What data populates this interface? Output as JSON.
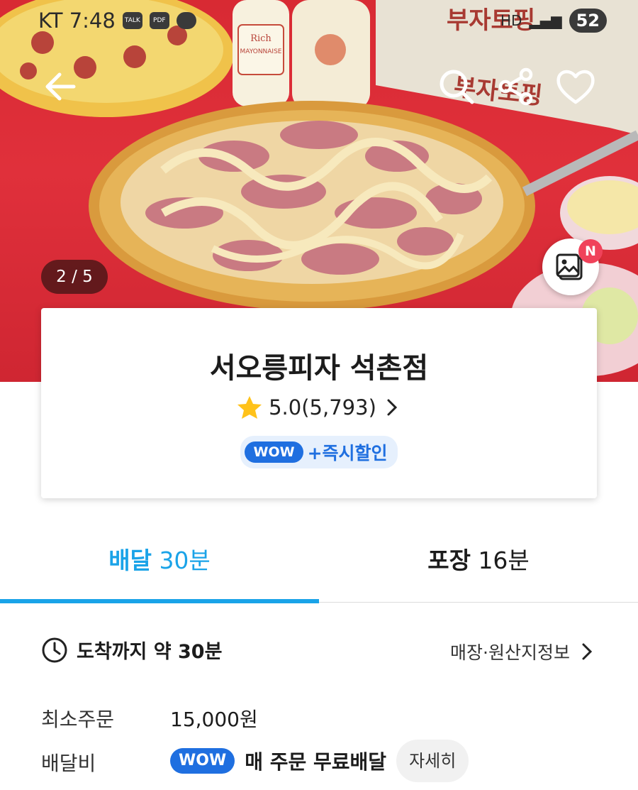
{
  "status_bar": {
    "carrier_time": "KT 7:48",
    "notif_icons": [
      "TALK",
      "PDF"
    ],
    "network": "HD",
    "battery": "52"
  },
  "hero": {
    "image_counter": "2 / 5",
    "gallery_badge": "N",
    "icons": [
      "back-arrow-icon",
      "search-icon",
      "share-icon",
      "heart-icon",
      "gallery-icon"
    ],
    "bottle_label": "Rich MAYONNAISE",
    "box_text": "부자토핑"
  },
  "store": {
    "name": "서오릉피자 석촌점",
    "rating": "5.0(5,793)",
    "wow_label": "WOW",
    "wow_promo": "+즉시할인"
  },
  "tabs": [
    {
      "label": "배달",
      "time": "30분",
      "active": true
    },
    {
      "label": "포장",
      "time": "16분",
      "active": false
    }
  ],
  "info": {
    "eta": "도착까지 약 30분",
    "store_info_link": "매장·원산지정보",
    "min_order_label": "최소주문",
    "min_order_value": "15,000원",
    "delivery_fee_label": "배달비",
    "wow_label": "WOW",
    "delivery_fee_value": "매 주문 무료배달",
    "detail_button": "자세히"
  },
  "colors": {
    "accent": "#1aa3e8",
    "wow_blue": "#1f6fe0",
    "badge_red": "#f0425a",
    "hero_red": "#e0303b"
  }
}
